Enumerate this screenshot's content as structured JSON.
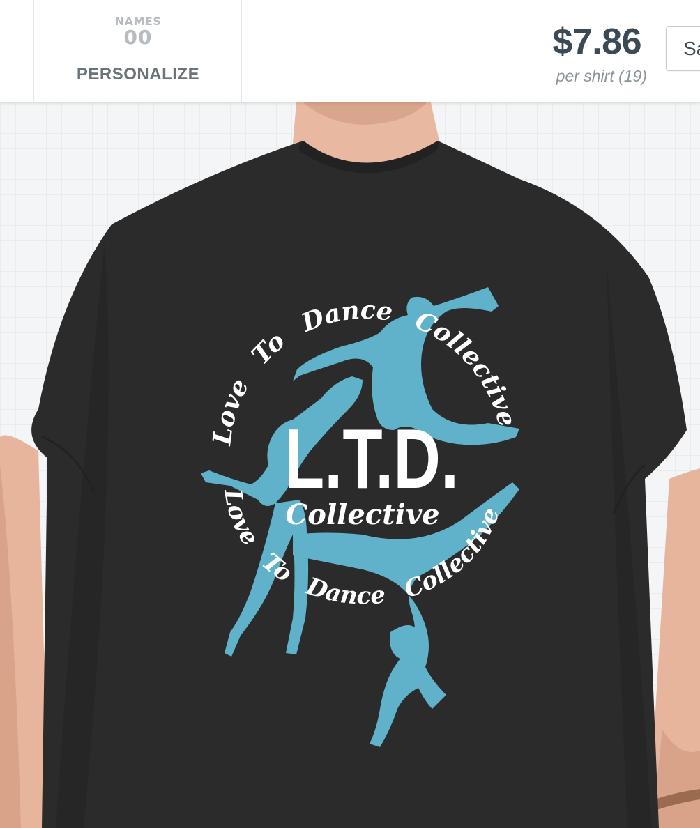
{
  "toolbar": {
    "personalize": {
      "names_label": "NAMES",
      "number": "00",
      "label": "PERSONALIZE"
    },
    "price": "$7.86",
    "per_shirt": "per shirt (19)",
    "save_button_label": "Sa"
  },
  "design": {
    "main_text": "L.T.D.",
    "sub_text": "Collective",
    "ring_upper": [
      "Love",
      "To",
      "Dance",
      "Collective"
    ],
    "ring_lower": [
      "Love",
      "To",
      "Dance",
      "Collective"
    ],
    "shirt_color": "#2b2b2b",
    "print_white": "#ffffff",
    "print_blue": "#5fb2ca"
  }
}
